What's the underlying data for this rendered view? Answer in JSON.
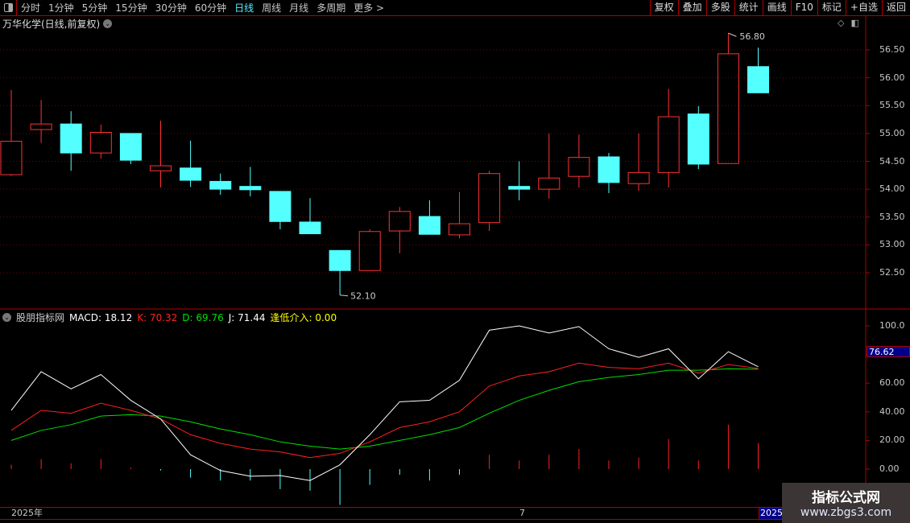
{
  "toolbar": {
    "periods": [
      "分时",
      "1分钟",
      "5分钟",
      "15分钟",
      "30分钟",
      "60分钟",
      "日线",
      "周线",
      "月线",
      "多周期",
      "更多 >"
    ],
    "active_period": "日线",
    "buttons": [
      "复权",
      "叠加",
      "多股",
      "统计",
      "画线",
      "F10",
      "标记",
      "+自选",
      "返回"
    ]
  },
  "chart": {
    "title": "万华化学(日线,前复权)",
    "high_label": "56.80",
    "low_label": "52.10",
    "price_ticks": [
      "56.50",
      "56.00",
      "55.50",
      "55.00",
      "54.50",
      "54.00",
      "53.50",
      "53.00",
      "52.50"
    ],
    "colors": {
      "up": "#ff3232",
      "down": "#54ffff"
    }
  },
  "indicator": {
    "name": "股朋指标网",
    "macd_label": "MACD: 18.12",
    "k_label": "K: 70.32",
    "d_label": "D: 69.76",
    "j_label": "J: 71.44",
    "signal_label": "逢低介入: 0.00",
    "ticks": [
      "100.0",
      "80.00",
      "60.00",
      "40.00",
      "20.00",
      "0.00"
    ],
    "current_value": "76.62",
    "colors": {
      "k": "#ff2020",
      "d": "#00e000",
      "j": "#ffffff",
      "signal": "#ffff00"
    }
  },
  "dates": {
    "start": "2025年",
    "mid": "7",
    "end": "2025"
  },
  "watermark": {
    "title": "指标公式网",
    "url": "www.zbgs3.com"
  },
  "chart_data": {
    "type": "candlestick",
    "candles": [
      {
        "o": 54.26,
        "c": 54.86,
        "h": 55.78,
        "l": 54.24
      },
      {
        "o": 55.07,
        "c": 55.17,
        "h": 55.6,
        "l": 54.83
      },
      {
        "o": 55.17,
        "c": 54.65,
        "h": 55.4,
        "l": 54.33
      },
      {
        "o": 54.65,
        "c": 55.02,
        "h": 55.16,
        "l": 54.55
      },
      {
        "o": 55.0,
        "c": 54.52,
        "h": 55.0,
        "l": 54.45
      },
      {
        "o": 54.33,
        "c": 54.42,
        "h": 55.23,
        "l": 54.03
      },
      {
        "o": 54.38,
        "c": 54.16,
        "h": 54.87,
        "l": 54.04
      },
      {
        "o": 54.14,
        "c": 54.0,
        "h": 54.28,
        "l": 53.9
      },
      {
        "o": 54.05,
        "c": 53.99,
        "h": 54.4,
        "l": 53.87
      },
      {
        "o": 53.96,
        "c": 53.42,
        "h": 53.96,
        "l": 53.28
      },
      {
        "o": 53.41,
        "c": 53.2,
        "h": 53.84,
        "l": 53.2
      },
      {
        "o": 52.9,
        "c": 52.54,
        "h": 52.9,
        "l": 52.1
      },
      {
        "o": 52.54,
        "c": 53.24,
        "h": 53.28,
        "l": 52.54
      },
      {
        "o": 53.25,
        "c": 53.6,
        "h": 53.68,
        "l": 52.85
      },
      {
        "o": 53.51,
        "c": 53.19,
        "h": 53.8,
        "l": 53.19
      },
      {
        "o": 53.18,
        "c": 53.38,
        "h": 53.95,
        "l": 53.12
      },
      {
        "o": 53.4,
        "c": 54.28,
        "h": 54.33,
        "l": 53.25
      },
      {
        "o": 54.05,
        "c": 54.0,
        "h": 54.5,
        "l": 53.8
      },
      {
        "o": 54.0,
        "c": 54.2,
        "h": 55.0,
        "l": 53.83
      },
      {
        "o": 54.23,
        "c": 54.57,
        "h": 54.98,
        "l": 54.03
      },
      {
        "o": 54.58,
        "c": 54.12,
        "h": 54.65,
        "l": 53.93
      },
      {
        "o": 54.1,
        "c": 54.3,
        "h": 55.0,
        "l": 53.97
      },
      {
        "o": 54.3,
        "c": 55.3,
        "h": 55.8,
        "l": 54.03
      },
      {
        "o": 55.35,
        "c": 54.45,
        "h": 55.49,
        "l": 54.36
      },
      {
        "o": 54.46,
        "c": 56.43,
        "h": 56.8,
        "l": 54.46
      },
      {
        "o": 56.2,
        "c": 55.73,
        "h": 56.54,
        "l": 55.73
      }
    ],
    "price_range": [
      52.2,
      56.9
    ],
    "indicator_range": [
      -28,
      108
    ],
    "K": [
      27,
      41,
      39,
      46,
      41,
      35,
      24,
      18,
      14,
      12,
      8,
      11,
      19,
      29,
      33,
      40,
      58,
      65,
      68,
      74,
      71,
      70,
      74,
      67,
      73,
      70.32
    ],
    "D": [
      20,
      27,
      31,
      37,
      38,
      37,
      33,
      28,
      24,
      19,
      16,
      14,
      16,
      20,
      24,
      29,
      39,
      48,
      55,
      61,
      64,
      66,
      69,
      69,
      70,
      69.76
    ],
    "J": [
      41,
      68,
      56,
      66,
      48,
      35,
      10,
      -1,
      -5,
      -4.5,
      -8,
      3,
      24,
      47,
      48,
      62,
      97,
      100,
      95,
      99.5,
      84,
      78,
      84,
      63,
      82,
      71.44
    ],
    "MACD": [
      3,
      7,
      4,
      7,
      1,
      -1,
      -6,
      -8,
      -8,
      -14,
      -15,
      -25,
      -11,
      -4,
      -8,
      -4,
      10,
      6,
      10,
      14,
      6,
      8,
      21,
      6,
      31,
      18.12
    ]
  }
}
